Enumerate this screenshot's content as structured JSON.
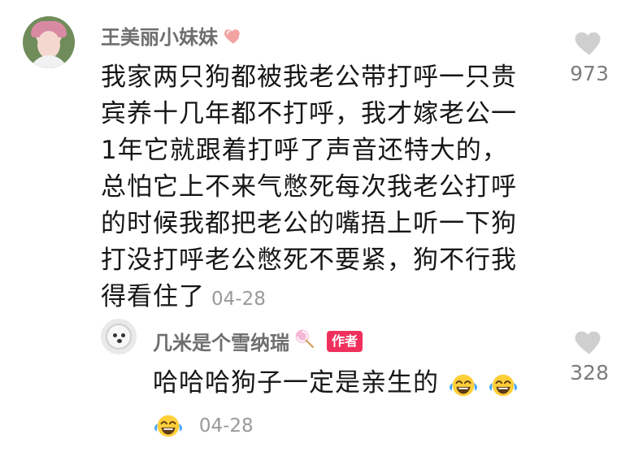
{
  "comment": {
    "author": "王美丽小妹妹",
    "author_emoji": "heart-emoji",
    "text": "我家两只狗都被我老公带打呼一只贵宾养十几年都不打呼，我才嫁老公一1年它就跟着打呼了声音还特大的，总怕它上不来气憋死每次我老公打呼的时候我都把老公的嘴捂上听一下狗打没打呼老公憋死不要紧，狗不行我得看住了",
    "date": "04-28",
    "like_icon": "heart-outline",
    "likes": "973"
  },
  "reply": {
    "author": "几米是个雪纳瑞",
    "author_emoji": "lollipop-emoji",
    "badge": "作者",
    "text": "哈哈哈狗子一定是亲生的",
    "emoji": "tears-of-joy",
    "emoji_count": 3,
    "date": "04-28",
    "like_icon": "heart-outline",
    "likes": "328"
  },
  "colors": {
    "text": "#161616",
    "meta": "#6e6e6e",
    "date": "#9a9a9a",
    "badge": "#f0305c",
    "heart_outline": "#c7c7c7"
  }
}
